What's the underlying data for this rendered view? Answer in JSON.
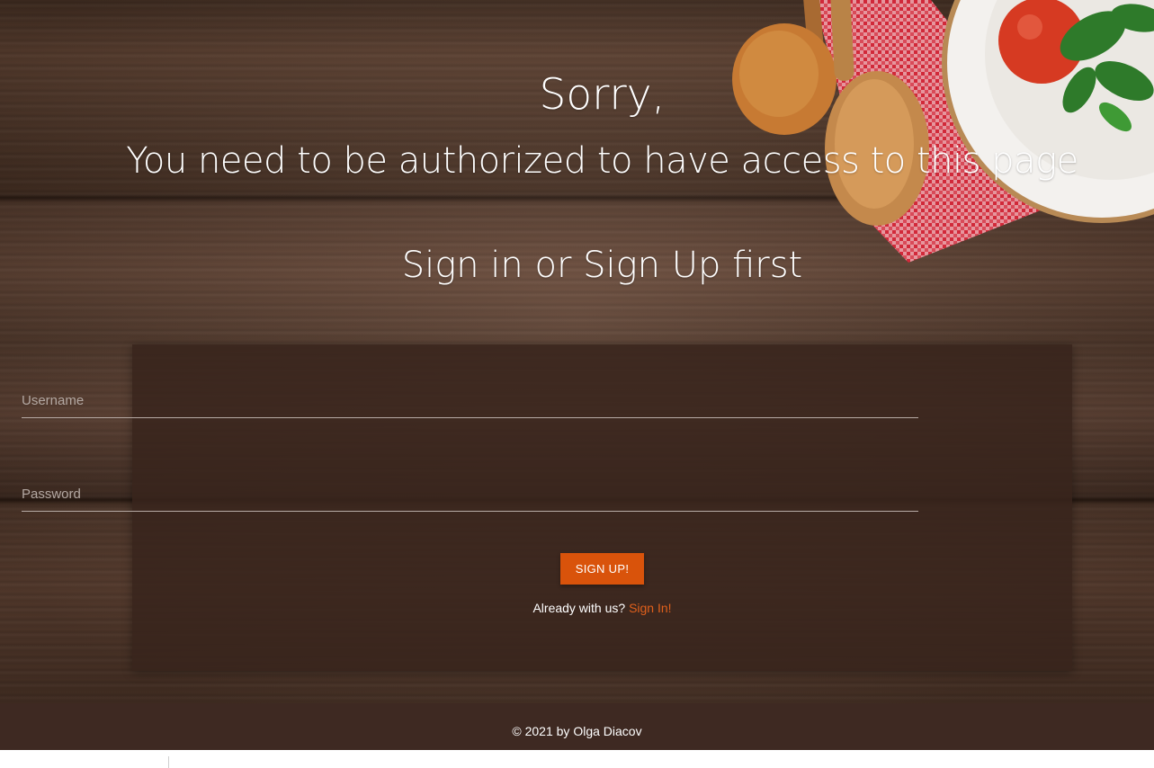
{
  "heading": {
    "line1": "Sorry,",
    "line2": "You need to be authorized to have access to this page",
    "line3": "Sign in or Sign Up first"
  },
  "form": {
    "username_placeholder": "Username",
    "username_value": "",
    "password_placeholder": "Password",
    "password_value": "",
    "submit_label": "SIGN UP!",
    "already_text": "Already with us?",
    "signin_link": "Sign In!"
  },
  "footer": {
    "text": "© 2021 by Olga Diacov"
  },
  "colors": {
    "accent": "#d9530b",
    "link": "#e0601c",
    "footer_bg": "#3e2922",
    "card_bg": "#38241c"
  }
}
